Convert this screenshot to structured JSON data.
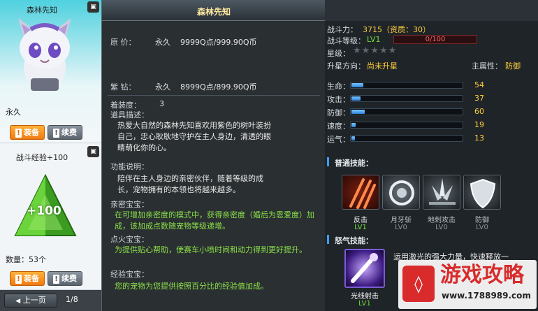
{
  "left": {
    "card1": {
      "title": "森林先知",
      "duration": "永久",
      "equip_label": "装备",
      "renew_label": "续费"
    },
    "card2": {
      "title": "战斗经验+100",
      "badge_text": "+100",
      "quantity": "数量：53个",
      "equip_label": "装备",
      "renew_label": "续费"
    },
    "pager": {
      "prev_label": "上一页",
      "page": "1/8"
    }
  },
  "main": {
    "title": "森林先知",
    "original_price_label": "原 价：",
    "original_price_term": "永久",
    "original_price_value": "9999Q点/999.90Q币",
    "diamond_label": "紫 钻：",
    "diamond_term": "永久",
    "diamond_value": "8999Q点/899.90Q币",
    "equip_count_label": "着装度：",
    "equip_count_value": "3",
    "desc_label": "道具描述：",
    "desc_text": "热爱大自然的森林先知喜欢用紫色的树叶装扮自己，忠心耿耿地守护在主人身边，清透的眼睛萌化你的心。",
    "function_label": "功能说明：",
    "function_text": "陪伴在主人身边的亲密伙伴，随着等级的成长，宠物拥有的本领也将越来越多。",
    "intimacy_label": "亲密宝宝：",
    "intimacy_text": "在可增加亲密度的模式中，获得亲密度（婚后为恩爱度）加成，该加成点数随宠物等级递增。",
    "fire_label": "点火宝宝：",
    "fire_text": "为提供贴心帮助，使赛车小喷时间和动力得到更好提升。",
    "exp_label": "经验宝宝：",
    "exp_text": "您的宠物为您提供按照百分比的经验值加成。"
  },
  "right": {
    "power_label": "战斗力：",
    "power_value": "3715（资质：30）",
    "level_label": "战斗等级：",
    "level_value": "LV1",
    "exp_text": "0/100",
    "star_label": "星级：",
    "stars_filled": 0,
    "stars_total": 5,
    "upgrade_label": "升星方向：",
    "upgrade_value": "尚未升星",
    "attribute_label": "主属性：",
    "attribute_value": "防御",
    "stats": [
      {
        "label": "生命：",
        "value": "54",
        "fill": 0.11
      },
      {
        "label": "攻击：",
        "value": "37",
        "fill": 0.08
      },
      {
        "label": "防御：",
        "value": "60",
        "fill": 0.12
      },
      {
        "label": "速度：",
        "value": "19",
        "fill": 0.04
      },
      {
        "label": "运气：",
        "value": "13",
        "fill": 0.03
      }
    ],
    "normal_skills_label": "普通技能：",
    "skills": [
      {
        "name": "反击",
        "level": "LV1",
        "icon": "claw-icon"
      },
      {
        "name": "月牙斩",
        "level": "LV0",
        "icon": "crescent-icon"
      },
      {
        "name": "地刺攻击",
        "level": "LV0",
        "icon": "spike-icon"
      },
      {
        "name": "防御",
        "level": "LV0",
        "icon": "shield-icon"
      }
    ],
    "rage_skills_label": "怒气技能：",
    "rage_skill": {
      "name": "光线射击",
      "level": "LV1",
      "icon": "laser-icon"
    },
    "rage_desc": "运用激光的强大力量，快速释放一",
    "watermark": "游戏攻略",
    "watermark_url": "www.1788989.com"
  },
  "colors": {
    "accent_orange": "#f07a10",
    "stat_value_gold": "#ffce3a",
    "level_green": "#6fe03a",
    "desc_green": "#8be04a",
    "bar_blue": "#2f7fd6"
  }
}
